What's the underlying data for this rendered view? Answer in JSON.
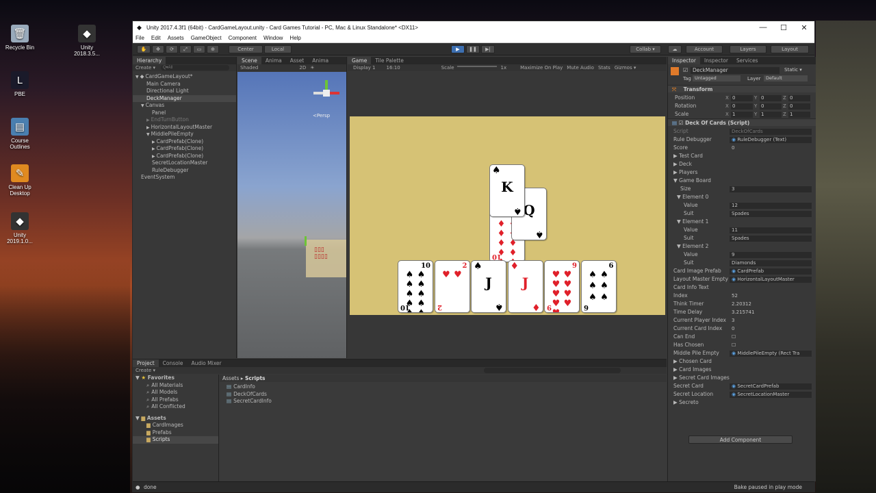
{
  "desktop": {
    "icons": [
      {
        "label": "Recycle Bin",
        "icon": "recycle-bin-icon",
        "glyph": "🗑"
      },
      {
        "label": "Unity 2018.3.5...",
        "icon": "unity-icon",
        "glyph": "◆"
      },
      {
        "label": "PBE",
        "icon": "league-icon",
        "glyph": "L"
      },
      {
        "label": "Course Outlines",
        "icon": "document-icon",
        "glyph": "▤"
      },
      {
        "label": "Clean Up Desktop",
        "icon": "cleanup-icon",
        "glyph": "✎"
      },
      {
        "label": "Unity 2019.1.0...",
        "icon": "unity-icon",
        "glyph": "◆"
      }
    ]
  },
  "window": {
    "title": "Unity 2017.4.3f1 (64bit) - CardGameLayout.unity - Card Games Tutorial - PC, Mac & Linux Standalone* <DX11>",
    "minimize": "—",
    "maximize": "☐",
    "close": "✕"
  },
  "menu": [
    "File",
    "Edit",
    "Assets",
    "GameObject",
    "Component",
    "Window",
    "Help"
  ],
  "toolbar": {
    "pivot": "Center",
    "space": "Local",
    "collab": "Collab ▾",
    "account": "Account",
    "layers": "Layers",
    "layout": "Layout"
  },
  "hierarchy": {
    "tab": "Hierarchy",
    "create": "Create ▾",
    "search_placeholder": "Q▾All",
    "rows": [
      {
        "label": "CardGameLayout*",
        "indent": 0,
        "arrow": "▼",
        "icon": "◆"
      },
      {
        "label": "Main Camera",
        "indent": 2,
        "arrow": "",
        "icon": ""
      },
      {
        "label": "Directional Light",
        "indent": 2,
        "arrow": "",
        "icon": ""
      },
      {
        "label": "DeckManager",
        "indent": 2,
        "arrow": "",
        "icon": "",
        "selected": true
      },
      {
        "label": "Canvas",
        "indent": 1,
        "arrow": "▼",
        "icon": ""
      },
      {
        "label": "Panel",
        "indent": 3,
        "arrow": "",
        "icon": ""
      },
      {
        "label": "EndTurnButton",
        "indent": 2,
        "arrow": "▶",
        "icon": "",
        "dim": true
      },
      {
        "label": "HorizontalLayoutMaster",
        "indent": 2,
        "arrow": "▶",
        "icon": ""
      },
      {
        "label": "MiddlePileEmpty",
        "indent": 2,
        "arrow": "▼",
        "icon": ""
      },
      {
        "label": "CardPrefab(Clone)",
        "indent": 3,
        "arrow": "▶",
        "icon": ""
      },
      {
        "label": "CardPrefab(Clone)",
        "indent": 3,
        "arrow": "▶",
        "icon": ""
      },
      {
        "label": "CardPrefab(Clone)",
        "indent": 3,
        "arrow": "▶",
        "icon": ""
      },
      {
        "label": "SecretLocationMaster",
        "indent": 3,
        "arrow": "",
        "icon": ""
      },
      {
        "label": "RuleDebugger",
        "indent": 3,
        "arrow": "",
        "icon": ""
      },
      {
        "label": "EventSystem",
        "indent": 1,
        "arrow": "",
        "icon": ""
      }
    ]
  },
  "scene": {
    "tabs": [
      "Scene",
      "Anima",
      "Asset",
      "Anima"
    ],
    "shading": "Shaded",
    "mode2d": "2D",
    "persp": "<Persp"
  },
  "game": {
    "tabs": [
      "Game",
      "Tile Palette"
    ],
    "display": "Display 1",
    "aspect": "16:10",
    "scale_label": "Scale",
    "scale_value": "1x",
    "maximize": "Maximize On Play",
    "mute": "Mute Audio",
    "stats": "Stats",
    "gizmos": "Gizmos ▾",
    "board_color": "#d6c275",
    "middle_cards": [
      {
        "rank": "K",
        "suit": "♠",
        "color": "black"
      },
      {
        "rank": "Q",
        "suit": "♠",
        "color": "black"
      },
      {
        "rank": "10",
        "suit": "♦",
        "color": "red"
      }
    ],
    "hand_cards": [
      {
        "rank": "10",
        "suit": "♠",
        "color": "black"
      },
      {
        "rank": "2",
        "suit": "♥",
        "color": "red"
      },
      {
        "rank": "J",
        "suit": "♠",
        "color": "black"
      },
      {
        "rank": "J",
        "suit": "♦",
        "color": "red"
      },
      {
        "rank": "9",
        "suit": "♥",
        "color": "red"
      },
      {
        "rank": "6",
        "suit": "♠",
        "color": "black"
      }
    ]
  },
  "inspector": {
    "tabs": [
      "Inspector",
      "Inspector",
      "Services"
    ],
    "object_name": "DeckManager",
    "static": "Static ▾",
    "tag_label": "Tag",
    "tag_value": "Untagged",
    "layer_label": "Layer",
    "layer_value": "Default",
    "transform_title": "Transform",
    "transform": [
      {
        "label": "Position",
        "x": "0",
        "y": "0",
        "z": "0"
      },
      {
        "label": "Rotation",
        "x": "0",
        "y": "0",
        "z": "0"
      },
      {
        "label": "Scale",
        "x": "1",
        "y": "1",
        "z": "1"
      }
    ],
    "component_title": "Deck Of Cards (Script)",
    "fields": [
      {
        "label": "Script",
        "value": "DeckOfCards",
        "kind": "faded",
        "labelDim": true
      },
      {
        "label": "Rule Debugger",
        "value": "RuleDebugger (Text)",
        "kind": "obj"
      },
      {
        "label": "Score",
        "value": "0",
        "kind": "plain"
      },
      {
        "label": "▶ Test Card",
        "value": "",
        "kind": "none",
        "head": true
      },
      {
        "label": "▶ Deck",
        "value": "",
        "kind": "none",
        "head": true
      },
      {
        "label": "▶ Players",
        "value": "",
        "kind": "none",
        "head": true
      },
      {
        "label": "▼ Game Board",
        "value": "",
        "kind": "none",
        "head": true
      },
      {
        "label": "Size",
        "value": "3",
        "kind": "box",
        "indent": 2
      },
      {
        "label": "▼ Element 0",
        "value": "",
        "kind": "none",
        "indent": 1
      },
      {
        "label": "Value",
        "value": "12",
        "kind": "box",
        "indent": 3
      },
      {
        "label": "Suit",
        "value": "Spades",
        "kind": "box",
        "indent": 3
      },
      {
        "label": "▼ Element 1",
        "value": "",
        "kind": "none",
        "indent": 1
      },
      {
        "label": "Value",
        "value": "11",
        "kind": "box",
        "indent": 3
      },
      {
        "label": "Suit",
        "value": "Spades",
        "kind": "box",
        "indent": 3
      },
      {
        "label": "▼ Element 2",
        "value": "",
        "kind": "none",
        "indent": 1
      },
      {
        "label": "Value",
        "value": "9",
        "kind": "box",
        "indent": 3
      },
      {
        "label": "Suit",
        "value": "Diamonds",
        "kind": "box",
        "indent": 3
      },
      {
        "label": "Card Image Prefab",
        "value": "CardPrefab",
        "kind": "obj"
      },
      {
        "label": "Layout Master Empty",
        "value": "HorizontalLayoutMaster",
        "kind": "obj"
      },
      {
        "label": "Card Info Text",
        "value": "",
        "kind": "none"
      },
      {
        "label": "Index",
        "value": "52",
        "kind": "plain"
      },
      {
        "label": "Think Timer",
        "value": "2.20312",
        "kind": "plain"
      },
      {
        "label": "Time Delay",
        "value": "3.215741",
        "kind": "plain"
      },
      {
        "label": "Current Player Index",
        "value": "3",
        "kind": "plain"
      },
      {
        "label": "Current Card Index",
        "value": "0",
        "kind": "plain"
      },
      {
        "label": "Can End",
        "value": "☐",
        "kind": "plain"
      },
      {
        "label": "Has Chosen",
        "value": "☐",
        "kind": "plain"
      },
      {
        "label": "Middle Pile Empty",
        "value": "MiddlePileEmpty (Rect Tra",
        "kind": "obj"
      },
      {
        "label": "▶ Chosen Card",
        "value": "",
        "kind": "none",
        "head": true
      },
      {
        "label": "▶ Card Images",
        "value": "",
        "kind": "none",
        "head": true
      },
      {
        "label": "▶ Secret Card Images",
        "value": "",
        "kind": "none",
        "head": true
      },
      {
        "label": "Secret Card",
        "value": "SecretCardPrefab",
        "kind": "obj"
      },
      {
        "label": "Secret Location",
        "value": "SecretLocationMaster",
        "kind": "obj"
      },
      {
        "label": "▶ Secreto",
        "value": "",
        "kind": "none",
        "head": true
      }
    ],
    "add_component": "Add Component"
  },
  "project": {
    "tabs": [
      "Project",
      "Console",
      "Audio Mixer"
    ],
    "create": "Create ▾",
    "favorites_title": "Favorites",
    "favorites": [
      "All Materials",
      "All Models",
      "All Prefabs",
      "All Conflicted"
    ],
    "assets_title": "Assets",
    "folders": [
      "CardImages",
      "Prefabs",
      "Scripts"
    ],
    "breadcrumb_root": "Assets",
    "breadcrumb_current": "Scripts",
    "files": [
      "CardInfo",
      "DeckOfCards",
      "SecretCardInfo"
    ]
  },
  "status": {
    "left": "done",
    "right": "Bake paused in play mode"
  }
}
